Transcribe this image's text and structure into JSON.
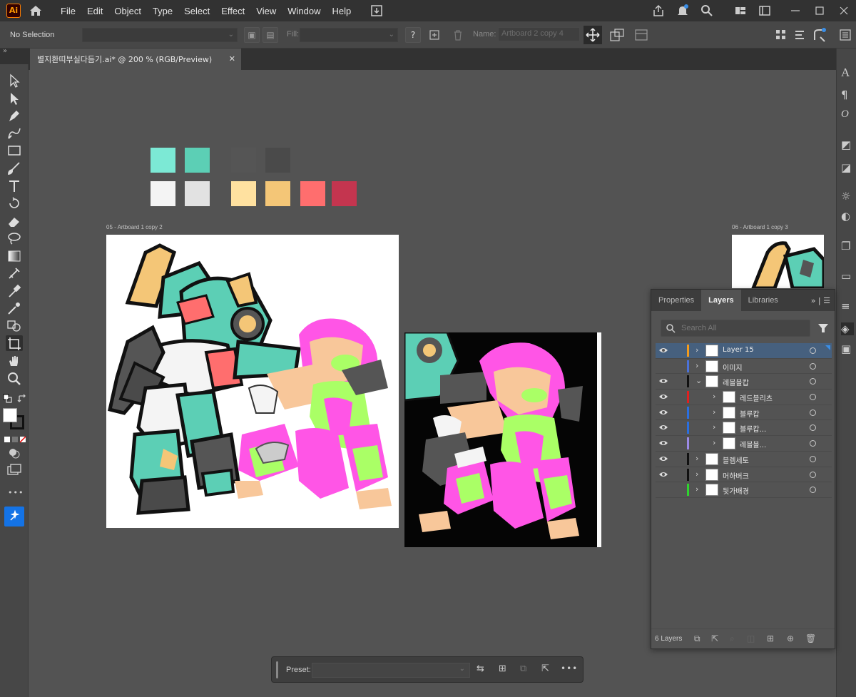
{
  "app": {
    "logo_text": "Ai",
    "menus": [
      "File",
      "Edit",
      "Object",
      "Type",
      "Select",
      "Effect",
      "View",
      "Window",
      "Help"
    ]
  },
  "control_bar": {
    "selection": "No Selection",
    "fill_label": "Fill:",
    "help_glyph": "?",
    "name_label": "Name:",
    "name_value": "Artboard 2 copy 4"
  },
  "document": {
    "tab_title": "별지환띠부실다듬기.ai* @ 200 % (RGB/Preview)",
    "close": "✕"
  },
  "palette": {
    "row1": [
      "#7ce9d5",
      "#5ccfb5",
      "#555555",
      "#4a4a4a"
    ],
    "row2": [
      "#f4f4f4",
      "#e2e2e2",
      "#ffe1a0",
      "#f4c677",
      "#ff6e6e",
      "#c4354f"
    ]
  },
  "artboards": {
    "left_label": "05 - Artboard 1 copy 2",
    "right_label": "06 - Artboard 1 copy 3"
  },
  "layers_panel": {
    "tabs": [
      "Properties",
      "Layers",
      "Libraries"
    ],
    "active_tab": "Layers",
    "search_placeholder": "Search All",
    "layers": [
      {
        "name": "Layer 15",
        "color": "#f29b1d",
        "visible": true,
        "expanded": false,
        "selected": true,
        "sub": false
      },
      {
        "name": "이미지",
        "color": "#4b72d9",
        "visible": false,
        "expanded": false,
        "selected": false,
        "sub": false
      },
      {
        "name": "레블블캅",
        "color": "#111111",
        "visible": true,
        "expanded": true,
        "selected": false,
        "sub": false
      },
      {
        "name": "레드블리츠",
        "color": "#e02020",
        "visible": true,
        "expanded": false,
        "selected": false,
        "sub": true
      },
      {
        "name": "블루캅",
        "color": "#2a6fe0",
        "visible": true,
        "expanded": false,
        "selected": false,
        "sub": true
      },
      {
        "name": "블루캅...",
        "color": "#2a6fe0",
        "visible": true,
        "expanded": false,
        "selected": false,
        "sub": true
      },
      {
        "name": "레블블...",
        "color": "#9b8ae6",
        "visible": true,
        "expanded": false,
        "selected": false,
        "sub": true
      },
      {
        "name": "블렘세토",
        "color": "#111111",
        "visible": true,
        "expanded": false,
        "selected": false,
        "sub": false
      },
      {
        "name": "머하버크",
        "color": "#111111",
        "visible": true,
        "expanded": false,
        "selected": false,
        "sub": false
      },
      {
        "name": "뒷가배경",
        "color": "#2ed42e",
        "visible": false,
        "expanded": false,
        "selected": false,
        "sub": false
      }
    ],
    "layer_count": "6 Layers"
  },
  "preset_bar": {
    "label": "Preset:",
    "more": "•••"
  },
  "toolbar": {
    "more": "•••"
  }
}
